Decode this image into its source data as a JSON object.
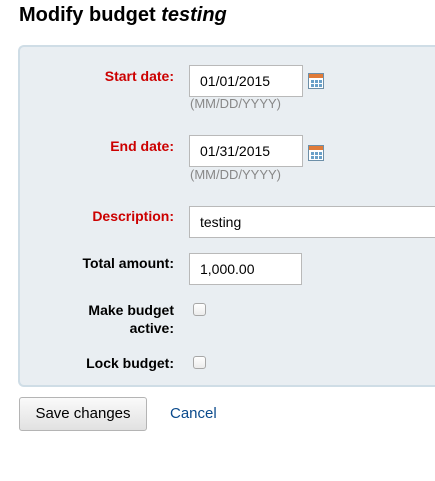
{
  "header": {
    "title_prefix": "Modify budget",
    "budget_name": "testing"
  },
  "form": {
    "start_date": {
      "label": "Start date:",
      "value": "01/01/2015",
      "hint": "(MM/DD/YYYY)",
      "required": true
    },
    "end_date": {
      "label": "End date:",
      "value": "01/31/2015",
      "hint": "(MM/DD/YYYY)",
      "required": true
    },
    "description": {
      "label": "Description:",
      "value": "testing",
      "required": true
    },
    "total_amount": {
      "label": "Total amount:",
      "value": "1,000.00"
    },
    "make_active": {
      "label": "Make budget active:",
      "checked": false
    },
    "lock_budget": {
      "label": "Lock budget:",
      "checked": false
    }
  },
  "actions": {
    "save_label": "Save changes",
    "cancel_label": "Cancel"
  },
  "colors": {
    "required_label": "#cc0000",
    "fieldset_bg": "#e9eef2",
    "link": "#0a4a8c"
  },
  "icons": {
    "calendar": "calendar-icon"
  }
}
